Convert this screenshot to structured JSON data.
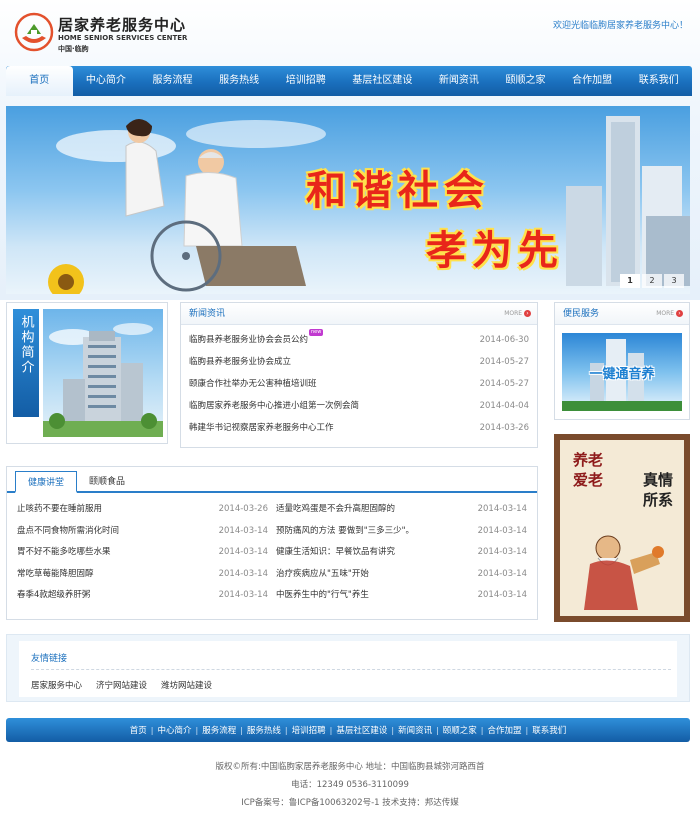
{
  "header": {
    "logo_cn": "居家养老服务中心",
    "logo_en": "HOME SENIOR SERVICES CENTER",
    "logo_loc": "中国·临朐",
    "welcome": "欢迎光临临朐居家养老服务中心！"
  },
  "nav": {
    "items": [
      {
        "label": "首页",
        "active": true
      },
      {
        "label": "中心简介"
      },
      {
        "label": "服务流程"
      },
      {
        "label": "服务热线"
      },
      {
        "label": "培训招聘"
      },
      {
        "label": "基层社区建设"
      },
      {
        "label": "新闻资讯"
      },
      {
        "label": "颐顺之家"
      },
      {
        "label": "合作加盟"
      },
      {
        "label": "联系我们"
      }
    ]
  },
  "banner": {
    "line1": "和谐社会",
    "line2": "孝为先",
    "dots": [
      "1",
      "2",
      "3"
    ],
    "active_dot": 0
  },
  "about": {
    "tag": "机构简介"
  },
  "news": {
    "title": "新闻资讯",
    "more": "MORE",
    "items": [
      {
        "title": "临朐县养老服务业协会会员公约",
        "date": "2014-06-30",
        "badge": "new"
      },
      {
        "title": "临朐县养老服务业协会成立",
        "date": "2014-05-27"
      },
      {
        "title": "颐康合作社举办无公害种植培训班",
        "date": "2014-05-27"
      },
      {
        "title": "临朐居家养老服务中心推进小组第一次例会简",
        "date": "2014-04-04"
      },
      {
        "title": "韩建华书记视察居家养老服务中心工作",
        "date": "2014-03-26"
      }
    ]
  },
  "service": {
    "title": "便民服务",
    "more": "MORE",
    "image_text": "一键通音养"
  },
  "scroll": {
    "left_text": "养老爱老",
    "right_text": "真情所系"
  },
  "health": {
    "tabs": [
      "健康讲堂",
      "颐顺食品"
    ],
    "left": [
      {
        "title": "止咳药不要在睡前服用",
        "date": "2014-03-26"
      },
      {
        "title": "盘点不同食物所需消化时间",
        "date": "2014-03-14"
      },
      {
        "title": "胃不好不能多吃哪些水果",
        "date": "2014-03-14"
      },
      {
        "title": "常吃草莓能降胆固醇",
        "date": "2014-03-14"
      },
      {
        "title": "春季4款超级养肝粥",
        "date": "2014-03-14"
      }
    ],
    "right": [
      {
        "title": "适量吃鸡蛋是不会升高胆固醇的",
        "date": "2014-03-14"
      },
      {
        "title": "预防痛风的方法 要做到\"三多三少\"。",
        "date": "2014-03-14"
      },
      {
        "title": "健康生活知识：早餐饮品有讲究",
        "date": "2014-03-14"
      },
      {
        "title": "治疗疾病应从\"五味\"开始",
        "date": "2014-03-14"
      },
      {
        "title": "中医养生中的\"行气\"养生",
        "date": "2014-03-14"
      }
    ]
  },
  "links": {
    "title": "友情链接",
    "items": [
      "居家服务中心",
      "济宁网站建设",
      "潍坊网站建设"
    ]
  },
  "footer": {
    "nav": [
      "首页",
      "中心简介",
      "服务流程",
      "服务热线",
      "培训招聘",
      "基层社区建设",
      "新闻资讯",
      "颐顺之家",
      "合作加盟",
      "联系我们"
    ],
    "separator": "|",
    "line1": "版权©所有:中国临朐家居养老服务中心  地址：中国临朐县城弥河路西首",
    "line2": "电话：12349 0536-3110099",
    "line3": "ICP备案号：鲁ICP备10063202号-1 技术支持：邦达传媒"
  },
  "colors": {
    "primary": "#1a6fbd",
    "accent_red": "#e8261a",
    "date_gray": "#8a8a8a"
  }
}
